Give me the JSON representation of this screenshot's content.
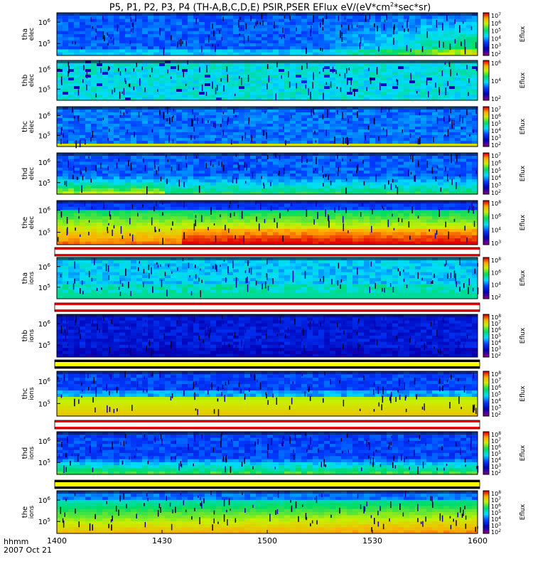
{
  "title": {
    "probes": "P5, P1, P2, P3, P4 (TH-A,B,C,D,E) PSIR,PSER EFlux eV/(eV*cm",
    "exp": "2",
    "tail": "*sec*sr)"
  },
  "time_axis": {
    "unit_label": "hhmm",
    "date_label": "2007 Oct 21",
    "ticks": [
      "1400",
      "1430",
      "1500",
      "1530",
      "1600"
    ]
  },
  "colorbar_label": "Eflux",
  "chart_data": [
    {
      "type": "heatmap",
      "name": "tha elec",
      "ylabel": [
        "tha",
        "elec"
      ],
      "yticks": [
        {
          "base": "10",
          "exp": "6"
        },
        {
          "base": "10",
          "exp": "5"
        }
      ],
      "colorbar_ticks": [
        "7",
        "6",
        "5",
        "4",
        "3",
        "2"
      ],
      "features": "mostly blue, green increasing after 1525"
    },
    {
      "type": "heatmap",
      "name": "thb elec",
      "ylabel": [
        "thb",
        "elec"
      ],
      "yticks": [
        {
          "base": "10",
          "exp": "6"
        },
        {
          "base": "10",
          "exp": "5"
        }
      ],
      "colorbar_ticks": [
        "6",
        "4",
        "2"
      ],
      "features": "cyan/green throughout"
    },
    {
      "type": "heatmap",
      "name": "thc elec",
      "ylabel": [
        "thc",
        "elec"
      ],
      "yticks": [
        {
          "base": "10",
          "exp": "6"
        },
        {
          "base": "10",
          "exp": "5"
        }
      ],
      "colorbar_ticks": [
        "7",
        "6",
        "5",
        "4",
        "3",
        "2"
      ],
      "features": "blue with yellow band at bottom"
    },
    {
      "type": "heatmap",
      "name": "thd elec",
      "ylabel": [
        "thd",
        "elec"
      ],
      "yticks": [
        {
          "base": "10",
          "exp": "6"
        },
        {
          "base": "10",
          "exp": "5"
        }
      ],
      "colorbar_ticks": [
        "7",
        "6",
        "5",
        "4",
        "3",
        "2"
      ],
      "features": "blue with green lower band"
    },
    {
      "type": "heatmap",
      "name": "the elec",
      "ylabel": [
        "the",
        "elec"
      ],
      "yticks": [
        {
          "base": "10",
          "exp": "6"
        },
        {
          "base": "10",
          "exp": "5"
        }
      ],
      "colorbar_ticks": [
        "8",
        "6",
        "4",
        "3"
      ],
      "features": "green/yellow/orange strong flux"
    },
    {
      "type": "heatmap",
      "name": "tha ions",
      "ylabel": [
        "tha",
        "ions"
      ],
      "yticks": [
        {
          "base": "10",
          "exp": "6"
        },
        {
          "base": "10",
          "exp": "5"
        }
      ],
      "colorbar_ticks": [
        "8",
        "6",
        "4",
        "2"
      ],
      "features": "cyan throughout"
    },
    {
      "type": "heatmap",
      "name": "thb ions",
      "ylabel": [
        "thb",
        "ions"
      ],
      "yticks": [
        {
          "base": "10",
          "exp": "6"
        },
        {
          "base": "10",
          "exp": "5"
        }
      ],
      "colorbar_ticks": [
        "8",
        "7",
        "6",
        "5",
        "4",
        "3",
        "2"
      ],
      "features": "dark blue throughout"
    },
    {
      "type": "heatmap",
      "name": "thc ions",
      "ylabel": [
        "thc",
        "ions"
      ],
      "yticks": [
        {
          "base": "10",
          "exp": "6"
        },
        {
          "base": "10",
          "exp": "5"
        }
      ],
      "colorbar_ticks": [
        "8",
        "7",
        "6",
        "5",
        "4",
        "3",
        "2"
      ],
      "features": "blue top, yellow-orange bottom"
    },
    {
      "type": "heatmap",
      "name": "thd ions",
      "ylabel": [
        "thd",
        "ions"
      ],
      "yticks": [
        {
          "base": "10",
          "exp": "6"
        },
        {
          "base": "10",
          "exp": "5"
        }
      ],
      "colorbar_ticks": [
        "8",
        "7",
        "6",
        "5",
        "4",
        "3",
        "2"
      ],
      "features": "blue with cyan lower region"
    },
    {
      "type": "heatmap",
      "name": "the ions",
      "ylabel": [
        "the",
        "ions"
      ],
      "yticks": [
        {
          "base": "10",
          "exp": "6"
        },
        {
          "base": "10",
          "exp": "5"
        }
      ],
      "colorbar_ticks": [
        "8",
        "7",
        "6",
        "5",
        "4",
        "3",
        "2"
      ],
      "features": "green/yellow strong flux"
    }
  ],
  "strips": [
    {
      "after_panel": "the elec",
      "colors": [
        "#ff0000",
        "#ffffff",
        "#ff0000"
      ]
    },
    {
      "after_panel": "tha ions",
      "colors": [
        "#ff0000",
        "#ffffff",
        "#ff0000"
      ]
    },
    {
      "after_panel": "thb ions",
      "colors": [
        "#000000",
        "#ffff00",
        "#000000"
      ]
    },
    {
      "after_panel": "thc ions",
      "colors": [
        "#ff0000",
        "#ffffff",
        "#ff0000"
      ]
    },
    {
      "after_panel": "thd ions",
      "colors": [
        "#000000",
        "#ffff00",
        "#000000"
      ]
    }
  ]
}
